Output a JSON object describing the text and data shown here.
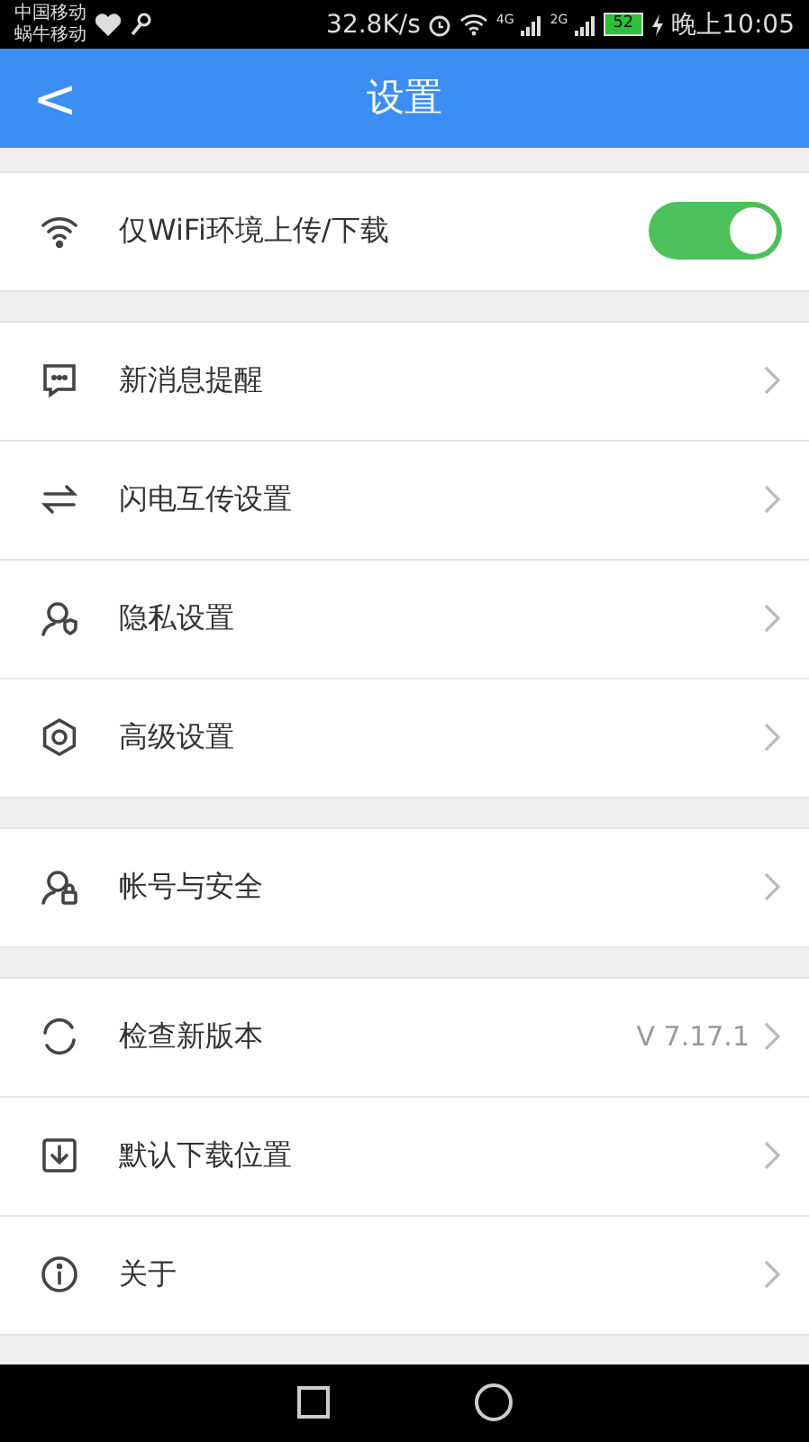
{
  "status_bar": {
    "carriers": [
      "中国移动",
      "蜗牛移动"
    ],
    "speed": "32.8K/s",
    "network_1": "4G",
    "network_2": "2G",
    "battery": "52",
    "time": "晚上10:05"
  },
  "header": {
    "back": "<",
    "title": "设置"
  },
  "groups": [
    [
      {
        "kind": "toggle",
        "label": "仅WiFi环境上传/下载",
        "on": true
      }
    ],
    [
      {
        "kind": "link",
        "label": "新消息提醒"
      },
      {
        "kind": "link",
        "label": "闪电互传设置"
      },
      {
        "kind": "link",
        "label": "隐私设置"
      },
      {
        "kind": "link",
        "label": "高级设置"
      }
    ],
    [
      {
        "kind": "link",
        "label": "帐号与安全"
      }
    ],
    [
      {
        "kind": "link",
        "label": "检查新版本",
        "value": "V 7.17.1"
      },
      {
        "kind": "link",
        "label": "默认下载位置"
      },
      {
        "kind": "link",
        "label": "关于"
      }
    ]
  ]
}
